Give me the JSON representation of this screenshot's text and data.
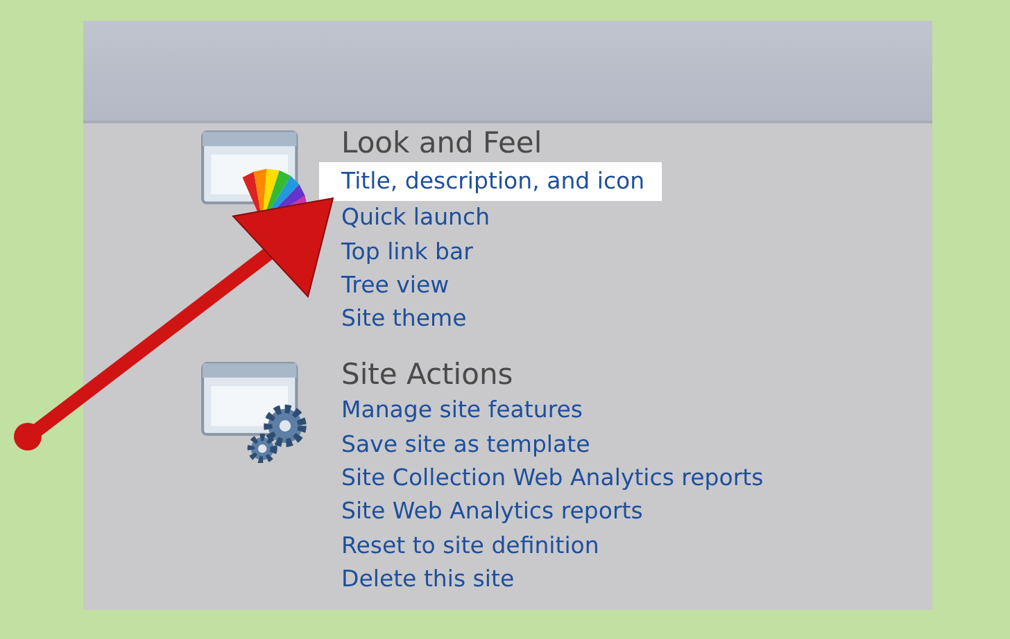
{
  "sections": [
    {
      "heading": "Look and Feel",
      "kind": "theme",
      "links": [
        {
          "label": "Title, description, and icon",
          "highlighted": true
        },
        {
          "label": "Quick launch",
          "highlighted": false
        },
        {
          "label": "Top link bar",
          "highlighted": false
        },
        {
          "label": "Tree view",
          "highlighted": false
        },
        {
          "label": "Site theme",
          "highlighted": false
        }
      ]
    },
    {
      "heading": "Site Actions",
      "kind": "gears",
      "links": [
        {
          "label": "Manage site features",
          "highlighted": false
        },
        {
          "label": "Save site as template",
          "highlighted": false
        },
        {
          "label": "Site Collection Web Analytics reports",
          "highlighted": false
        },
        {
          "label": "Site Web Analytics reports",
          "highlighted": false
        },
        {
          "label": "Reset to site definition",
          "highlighted": false
        },
        {
          "label": "Delete this site",
          "highlighted": false
        }
      ]
    }
  ]
}
